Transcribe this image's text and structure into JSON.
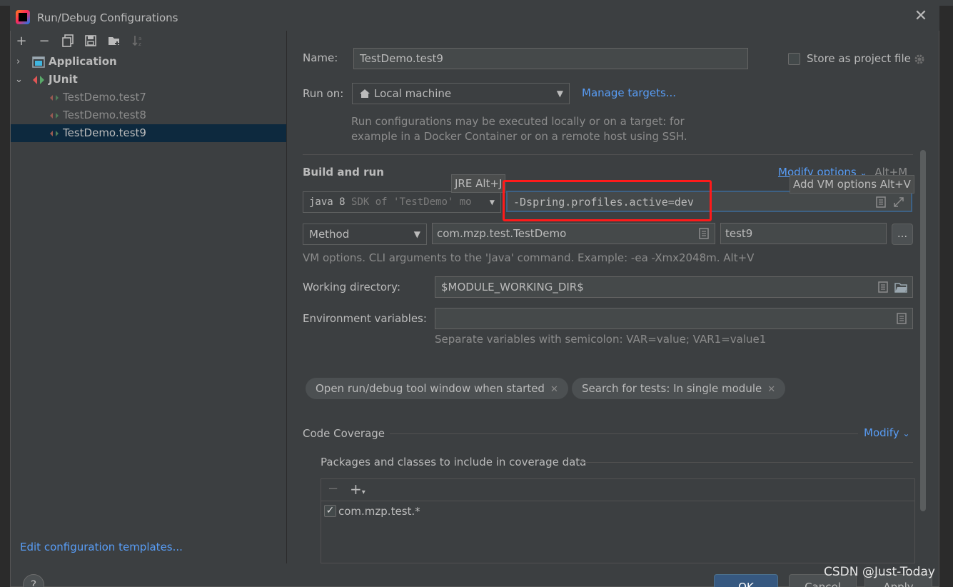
{
  "dialog": {
    "title": "Run/Debug Configurations",
    "close_icon": "close-icon"
  },
  "toolbar": {
    "add": "+",
    "remove": "−",
    "copy": "copy-icon",
    "save": "save-icon",
    "folder": "folder-icon",
    "sort": "sort-icon"
  },
  "tree": {
    "items": [
      {
        "label": "Application",
        "level": 0,
        "expanded": false,
        "bold": true
      },
      {
        "label": "JUnit",
        "level": 0,
        "expanded": true,
        "bold": true
      },
      {
        "label": "TestDemo.test7",
        "level": 1
      },
      {
        "label": "TestDemo.test8",
        "level": 1
      },
      {
        "label": "TestDemo.test9",
        "level": 1,
        "selected": true
      }
    ]
  },
  "edit_templates": "Edit configuration templates...",
  "form": {
    "name_label": "Name:",
    "name_value": "TestDemo.test9",
    "store_label": "Store as project file",
    "run_on_label": "Run on:",
    "run_on_value": "Local machine",
    "manage_targets": "Manage targets...",
    "run_on_hint_1": "Run configurations may be executed locally or on a target: for",
    "run_on_hint_2": "example in a Docker Container or on a remote host using SSH.",
    "build_and_run": "Build and run",
    "modify_options": "Modify options",
    "modify_options_shortcut": "Alt+M",
    "jre_tooltip": "JRE Alt+J",
    "add_vm_tooltip": "Add VM options Alt+V",
    "jre_value_a": "java 8",
    "jre_value_b": "SDK of 'TestDemo' mo",
    "vm_options_value": "-Dspring.profiles.active=dev",
    "test_kind": "Method",
    "class_value": "com.mzp.test.TestDemo",
    "method_value": "test9",
    "ellipsis": "...",
    "vm_hint": "VM options. CLI arguments to the 'Java' command. Example: -ea -Xmx2048m. Alt+V",
    "working_dir_label": "Working directory:",
    "working_dir_value": "$MODULE_WORKING_DIR$",
    "env_label": "Environment variables:",
    "env_value": "",
    "env_hint": "Separate variables with semicolon: VAR=value; VAR1=value1",
    "chip_1": "Open run/debug tool window when started",
    "chip_2": "Search for tests: In single module",
    "code_coverage": "Code Coverage",
    "modify": "Modify",
    "packages_label": "Packages and classes to include in coverage data",
    "package_item": "com.mzp.test.*"
  },
  "buttons": {
    "help": "?",
    "ok": "OK",
    "cancel": "Cancel",
    "apply": "Apply"
  },
  "watermark": "CSDN @Just-Today",
  "colors": {
    "link": "#589df6",
    "selection": "#0d293e",
    "highlight": "#ff1a1a"
  }
}
